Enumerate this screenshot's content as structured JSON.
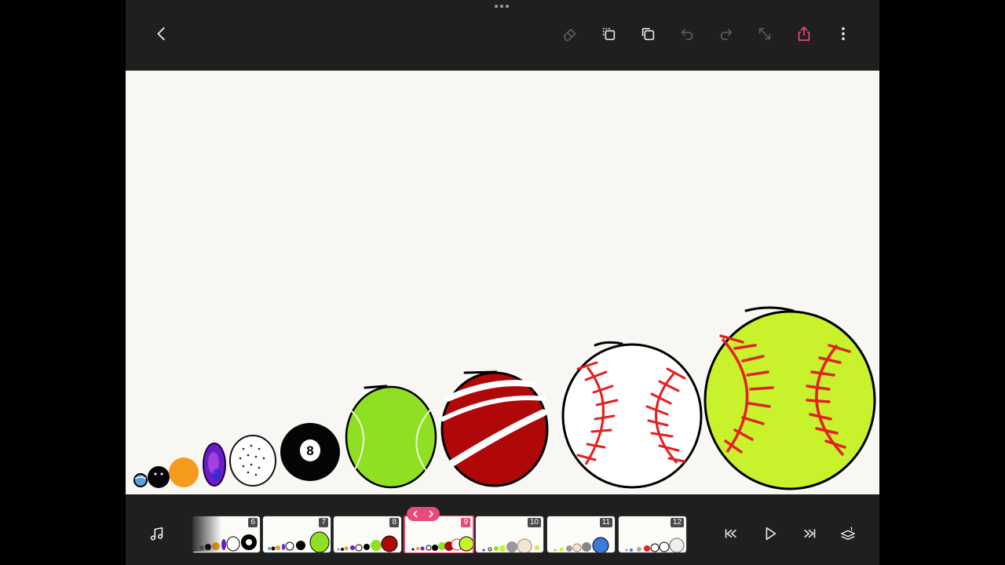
{
  "toolbar": {
    "icons": [
      "back-chevron-icon",
      "eraser-icon",
      "copy-frame-icon",
      "duplicate-icon",
      "undo-icon",
      "redo-icon",
      "resize-icon",
      "share-icon",
      "more-icon"
    ],
    "share_color": "#e84a7a",
    "disabled_color": "#5c5c5c"
  },
  "timeline": {
    "frames": [
      {
        "number": "6"
      },
      {
        "number": "7"
      },
      {
        "number": "8"
      },
      {
        "number": "9",
        "active": true
      },
      {
        "number": "10"
      },
      {
        "number": "11"
      },
      {
        "number": "12"
      }
    ],
    "accent": "#e84a7a"
  },
  "playback": {
    "icons": [
      "music-icon",
      "skip-to-start-icon",
      "play-icon",
      "skip-to-end-icon",
      "onion-skin-icon"
    ]
  },
  "canvas": {
    "background": "#f8f7f4",
    "drawing_subject": [
      "small-blue-ball",
      "black-ball",
      "orange-ball",
      "purple-ball",
      "golf-ball",
      "eight-ball",
      "tennis-ball",
      "cricket-ball",
      "baseball",
      "softball"
    ],
    "eight_ball_label": "8"
  }
}
